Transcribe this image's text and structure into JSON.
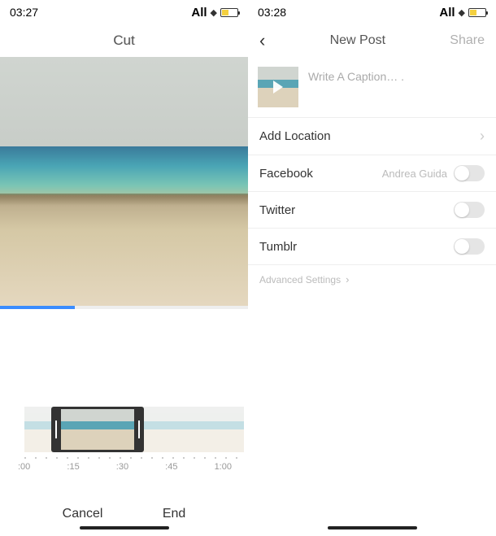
{
  "left": {
    "status": {
      "time": "03:27",
      "carrier": "All"
    },
    "nav": {
      "title": "Cut"
    },
    "timeline": {
      "labels": [
        ":00",
        ":15",
        ":30",
        ":45",
        "1:00"
      ]
    },
    "actions": {
      "cancel": "Cancel",
      "end": "End"
    }
  },
  "right": {
    "status": {
      "time": "03:28",
      "carrier": "All"
    },
    "nav": {
      "back": "‹",
      "title": "New Post",
      "share": "Share"
    },
    "caption": {
      "placeholder": "Write A Caption… ."
    },
    "rows": {
      "location": {
        "label": "Add Location"
      },
      "facebook": {
        "label": "Facebook",
        "user": "Andrea Guida"
      },
      "twitter": {
        "label": "Twitter"
      },
      "tumblr": {
        "label": "Tumblr"
      }
    },
    "advanced": {
      "label": "Advanced Settings"
    }
  }
}
